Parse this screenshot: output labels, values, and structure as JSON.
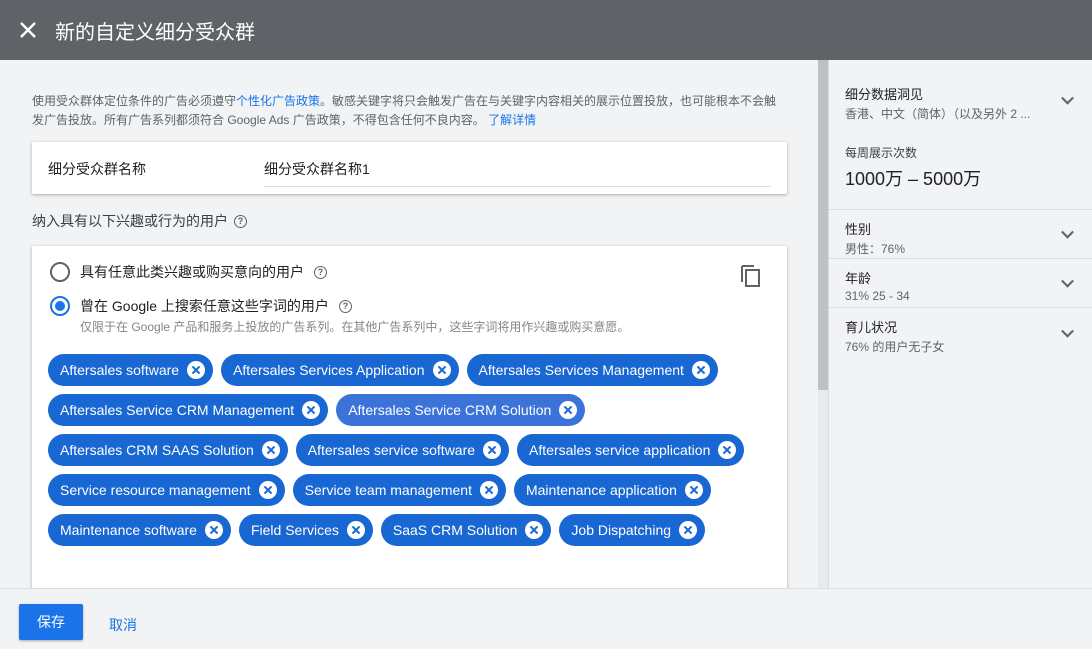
{
  "header": {
    "title": "新的自定义细分受众群",
    "close_icon": "close-icon"
  },
  "notice": {
    "text1": "使用受众群体定位条件的广告必须遵守",
    "link1": "个性化广告政策",
    "text2": "。敏感关键字将只会触发广告在与关键字内容相关的展示位置投放，也可能根本不会触发广告投放。所有广告系列都须符合 Google Ads 广告政策，不得包含任何不良内容。",
    "link2": "了解详情"
  },
  "name_field": {
    "label": "细分受众群名称",
    "value": "细分受众群名称1"
  },
  "section_label": "纳入具有以下兴趣或行为的用户",
  "options": [
    {
      "label": "具有任意此类兴趣或购买意向的用户",
      "selected": false
    },
    {
      "label": "曾在 Google 上搜索任意这些字词的用户",
      "selected": true,
      "sub": "仅限于在 Google 产品和服务上投放的广告系列。在其他广告系列中，这些字词将用作兴趣或购买意愿。"
    }
  ],
  "chips": [
    "Aftersales software",
    "Aftersales Services Application",
    "Aftersales Services Management",
    "Aftersales Service CRM Management",
    "Aftersales Service CRM Solution",
    "Aftersales CRM SAAS Solution",
    "Aftersales service software",
    "Aftersales service application",
    "Service resource management",
    "Service team management",
    "Maintenance application",
    "Maintenance software",
    "Field Services",
    "SaaS CRM Solution",
    "Job Dispatching"
  ],
  "insights": [
    {
      "title": "细分数据洞见",
      "value": "香港、中文（简体）（以及另外 2 ..."
    },
    {
      "title": "性别",
      "value": "男性：76%"
    },
    {
      "title": "年龄",
      "value": "31% 25 - 34"
    },
    {
      "title": "育儿状况",
      "value": "76% 的用户无子女"
    }
  ],
  "impressions": {
    "label": "每周展示次数",
    "value": "1000万 – 5000万"
  },
  "footer": {
    "save": "保存",
    "cancel": "取消"
  },
  "colors": {
    "accent": "#1a73e8",
    "chip": "#1967d2",
    "header": "#5f6368"
  }
}
